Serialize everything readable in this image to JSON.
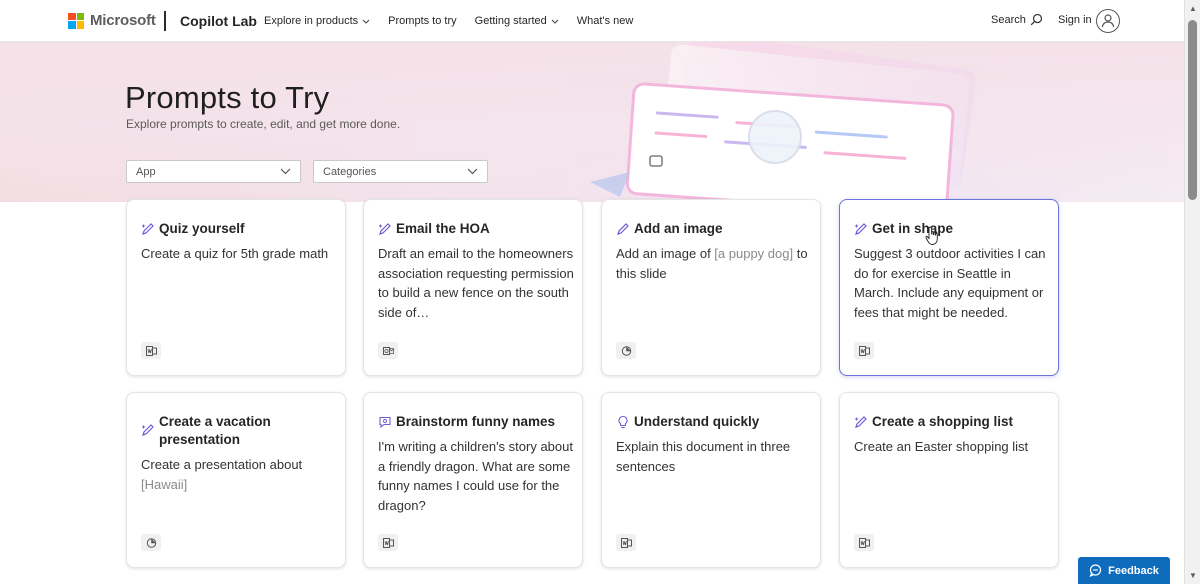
{
  "header": {
    "brand": "Microsoft",
    "product": "Copilot Lab",
    "nav": [
      {
        "label": "Explore in products",
        "dropdown": true
      },
      {
        "label": "Prompts to try",
        "dropdown": false
      },
      {
        "label": "Getting started",
        "dropdown": true
      },
      {
        "label": "What's new",
        "dropdown": false
      }
    ],
    "search_label": "Search",
    "signin_label": "Sign in"
  },
  "hero": {
    "title": "Prompts to Try",
    "subtitle": "Explore prompts to create, edit, and get more done."
  },
  "filters": {
    "app": "App",
    "categories": "Categories"
  },
  "cards": [
    {
      "title": "Quiz yourself",
      "body_text": "Create a quiz for 5th grade math",
      "placeholder": "",
      "body_after": "",
      "icon": "pen-sparkle-icon",
      "app_icon": "word-app-icon"
    },
    {
      "title": "Email the HOA",
      "body_text": "Draft an email to the homeowners association requesting permission to build a new fence on the south side of…",
      "placeholder": "",
      "body_after": "",
      "icon": "pen-sparkle-icon",
      "app_icon": "outlook-app-icon"
    },
    {
      "title": "Add an image",
      "body_text": "Add an image of ",
      "placeholder": "[a puppy dog]",
      "body_after": " to this slide",
      "icon": "pencil-icon",
      "app_icon": "powerpoint-app-icon"
    },
    {
      "title": "Get in shape",
      "body_text": "Suggest 3 outdoor activities I can do for exercise in Seattle in March. Include any equipment or fees that might be needed.",
      "placeholder": "",
      "body_after": "",
      "icon": "pen-sparkle-icon",
      "app_icon": "word-app-icon"
    },
    {
      "title": "Create a vacation presentation",
      "body_text": "Create a presentation about ",
      "placeholder": "[Hawaii]",
      "body_after": "",
      "icon": "pen-sparkle-icon",
      "app_icon": "powerpoint-app-icon"
    },
    {
      "title": "Brainstorm funny names",
      "body_text": "I'm writing a children's story about a friendly dragon. What are some funny names I could use for the dragon?",
      "placeholder": "",
      "body_after": "",
      "icon": "chat-bubble-icon",
      "app_icon": "word-app-icon"
    },
    {
      "title": "Understand quickly",
      "body_text": "Explain this document in three sentences",
      "placeholder": "",
      "body_after": "",
      "icon": "lightbulb-icon",
      "app_icon": "word-app-icon"
    },
    {
      "title": "Create a shopping list",
      "body_text": "Create an Easter shopping list",
      "placeholder": "",
      "body_after": "",
      "icon": "pen-sparkle-icon",
      "app_icon": "word-app-icon"
    }
  ],
  "feedback_label": "Feedback",
  "colors": {
    "ms_red": "#f25022",
    "ms_green": "#7fba00",
    "ms_blue": "#00a4ef",
    "ms_yellow": "#ffb900",
    "accent": "#0f6cbd",
    "icon_purple": "#6b5fd6"
  }
}
